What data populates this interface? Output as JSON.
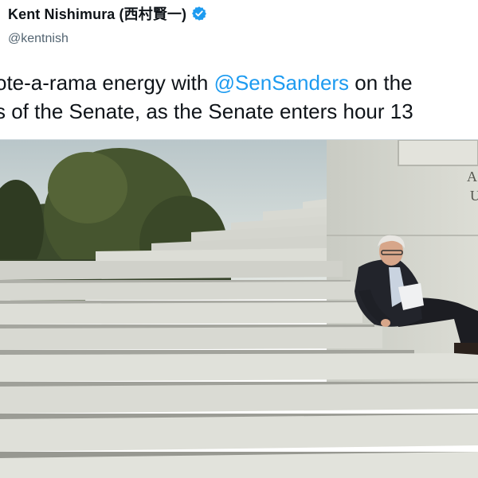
{
  "author": {
    "display_name": "Kent Nishimura (西村賢一)",
    "handle": "@kentnish",
    "verified": true,
    "verified_color": "#1d9bf0"
  },
  "tweet": {
    "line1_before": "ote-a-rama energy with ",
    "line1_mention": "@SenSanders",
    "line1_after": " on the",
    "line2": "s of the Senate, as the Senate enters hour 13",
    "mention_color": "#1d9bf0"
  },
  "media": {
    "type": "photo",
    "building_inscription": [
      "A",
      "U"
    ]
  }
}
